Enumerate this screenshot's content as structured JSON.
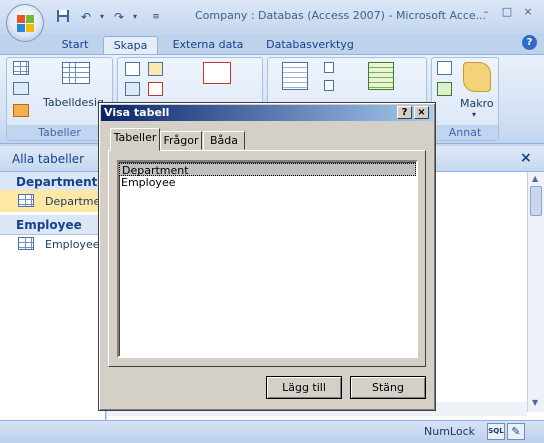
{
  "window": {
    "title": "Company : Databas (Access 2007) - Microsoft Acce..."
  },
  "quick_access": {
    "save_icon": "save-icon",
    "undo_icon": "undo-icon",
    "redo_icon": "redo-icon",
    "customize_icon": "customize-icon"
  },
  "window_controls": {
    "minimize": "–",
    "maximize": "□",
    "close": "×"
  },
  "ribbon": {
    "tabs": [
      {
        "label": "Start",
        "active": false
      },
      {
        "label": "Skapa",
        "active": true
      },
      {
        "label": "Externa data",
        "active": false
      },
      {
        "label": "Databasverktyg",
        "active": false
      }
    ],
    "groups": [
      {
        "label": "Tabeller",
        "button_label": "Tabelldesig"
      },
      {
        "label": "",
        "button_label": ""
      },
      {
        "label": "Annat",
        "button_label": "Makro"
      }
    ],
    "help": "?"
  },
  "nav_pane": {
    "title": "Alla tabeller",
    "groups": [
      {
        "label": "Department",
        "items": [
          {
            "label": "Departmen",
            "selected": true
          }
        ]
      },
      {
        "label": "Employee",
        "items": [
          {
            "label": "Employee :",
            "selected": false
          }
        ]
      }
    ]
  },
  "main": {
    "close_label": "×"
  },
  "status_bar": {
    "numlock": "NumLock",
    "sql_label": "SQL"
  },
  "dialog": {
    "title": "Visa tabell",
    "help_button": "?",
    "close_button": "×",
    "tabs": [
      {
        "label": "Tabeller",
        "active": true
      },
      {
        "label": "Frågor",
        "active": false
      },
      {
        "label": "Båda",
        "active": false
      }
    ],
    "tables": [
      {
        "name": "Department",
        "selected": true
      },
      {
        "name": "Employee",
        "selected": false
      }
    ],
    "add_button": "Lägg till",
    "close_action": "Stäng"
  },
  "colors": {
    "accent": "#15428b",
    "ribbon_bg": "#d3e1f3",
    "dialog_title": "#0a246a",
    "selection": "#ffe8a6"
  }
}
